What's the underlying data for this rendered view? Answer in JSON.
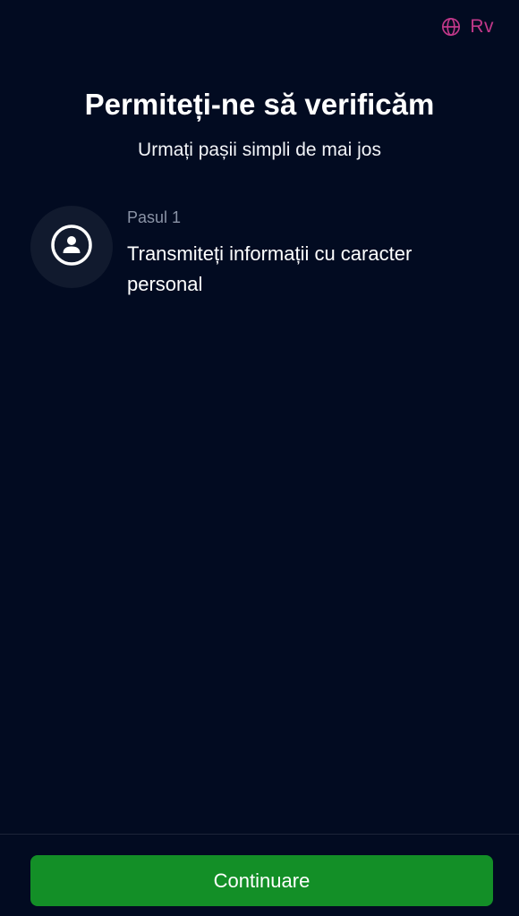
{
  "header": {
    "language_icon": "globe-icon",
    "language_label": "Rv"
  },
  "main": {
    "title": "Permiteți-ne să verificăm",
    "subtitle": "Urmați pașii simpli de mai jos",
    "steps": [
      {
        "icon": "person-circle-icon",
        "label": "Pasul 1",
        "description": "Transmiteți informații cu caracter personal"
      }
    ]
  },
  "footer": {
    "continue_label": "Continuare"
  },
  "colors": {
    "background": "#020b21",
    "accent": "#c2388a",
    "button": "#138f27",
    "icon_bg": "#111a2e",
    "muted_text": "#8a93a6"
  }
}
